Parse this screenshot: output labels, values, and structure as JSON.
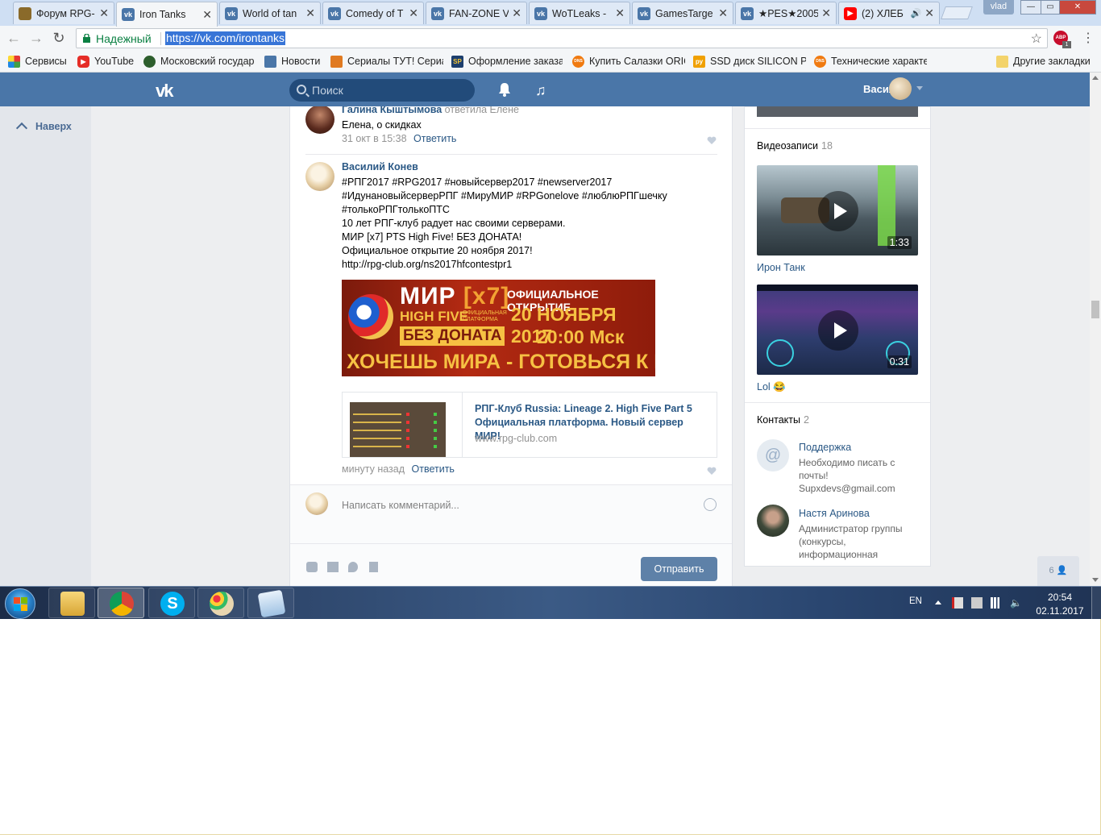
{
  "browser": {
    "tabs": [
      {
        "title": "Форум RPG-",
        "icon": "rpg"
      },
      {
        "title": "Iron Tanks",
        "icon": "vk",
        "active": true
      },
      {
        "title": "World of tan",
        "icon": "vk"
      },
      {
        "title": "Comedy of T",
        "icon": "vk"
      },
      {
        "title": "FAN-ZONE V",
        "icon": "vk"
      },
      {
        "title": "WoTLeaks - ",
        "icon": "vk"
      },
      {
        "title": "GamesTarge",
        "icon": "vk"
      },
      {
        "title": "★PES★2005",
        "icon": "vk"
      },
      {
        "title": "(2) ХЛЕБ",
        "icon": "yt"
      }
    ],
    "profile": "vlad",
    "secure_label": "Надежный",
    "url": "https://vk.com/irontanks",
    "abp_count": "1",
    "bookmarks": [
      {
        "label": "Сервисы",
        "icon": "apps-icon"
      },
      {
        "label": "YouTube",
        "icon": "youtube-icon"
      },
      {
        "label": "Московский государ",
        "icon": "crest-icon"
      },
      {
        "label": "Новости",
        "icon": "news-icon"
      },
      {
        "label": "Сериалы ТУТ! Сериа",
        "icon": "serials-icon"
      },
      {
        "label": "Оформление заказа",
        "icon": "sp-icon"
      },
      {
        "label": "Купить Салазки ORIC",
        "icon": "dns-icon"
      },
      {
        "label": "SSD диск SILICON PC",
        "icon": "py-icon"
      },
      {
        "label": "Технические характе",
        "icon": "dns-icon"
      },
      {
        "label": "Другие закладки",
        "icon": "folder-icon"
      }
    ]
  },
  "vk": {
    "search_placeholder": "Поиск",
    "username": "Василий",
    "back_to_top": "Наверх",
    "comment1": {
      "author": "Галина Кыштымова",
      "action": "ответила Елене",
      "text": "Елена, о скидках",
      "time": "31 окт в 15:38",
      "reply": "Ответить"
    },
    "comment2": {
      "author": "Василий Конев",
      "lines": [
        "#РПГ2017 #RPG2017 #новыйсервер2017 #newserver2017",
        "#ИдунановыйсерверРПГ #МируМИР #RPGonelove #люблюРПГшечку",
        "#толькоРПГтолькоПТС",
        "10 лет РПГ-клуб радует нас своими серверами.",
        "МИР [x7] PTS High Five! БЕЗ ДОНАТА!",
        "Официальное открытие 20 ноября 2017!",
        "http://rpg-club.org/ns2017hfcontestpr1"
      ],
      "banner": {
        "mir": "МИР",
        "x7": "[x7]",
        "high_five": "HIGH FIVE",
        "platform": "ОФИЦИАЛЬНАЯ ПЛАТФОРМА",
        "no_donate": "БЕЗ ДОНАТА",
        "opening": "ОФИЦИАЛЬНОЕ ОТКРЫТИЕ",
        "date": "20 НОЯБРЯ 2017",
        "time": "20:00 Мск",
        "slogan": "ХОЧЕШЬ МИРА - ГОТОВЬСЯ К ВОЙНЕ"
      },
      "snippet_title": "РПГ-Клуб Russia: Lineage 2. High Five Part 5 Официальная платформа. Новый сервер МИР!",
      "snippet_domain": "www.rpg-club.com",
      "time": "минуту назад",
      "reply": "Ответить"
    },
    "comment_placeholder": "Написать комментарий...",
    "send_label": "Отправить",
    "videos": {
      "label": "Видеозаписи",
      "count": "18",
      "items": [
        {
          "title": "Ирон Танк",
          "duration": "1:33"
        },
        {
          "title": "Lol 😂",
          "duration": "0:31"
        }
      ]
    },
    "contacts": {
      "label": "Контакты",
      "count": "2",
      "items": [
        {
          "name": "Поддержка",
          "desc": "Необходимо писать с почты! Supxdevs@gmail.com"
        },
        {
          "name": "Настя Аринова",
          "desc": "Администратор группы (конкурсы, информационная"
        }
      ]
    },
    "people_count": "6"
  },
  "taskbar": {
    "lang": "EN",
    "time": "20:54",
    "date": "02.11.2017"
  }
}
